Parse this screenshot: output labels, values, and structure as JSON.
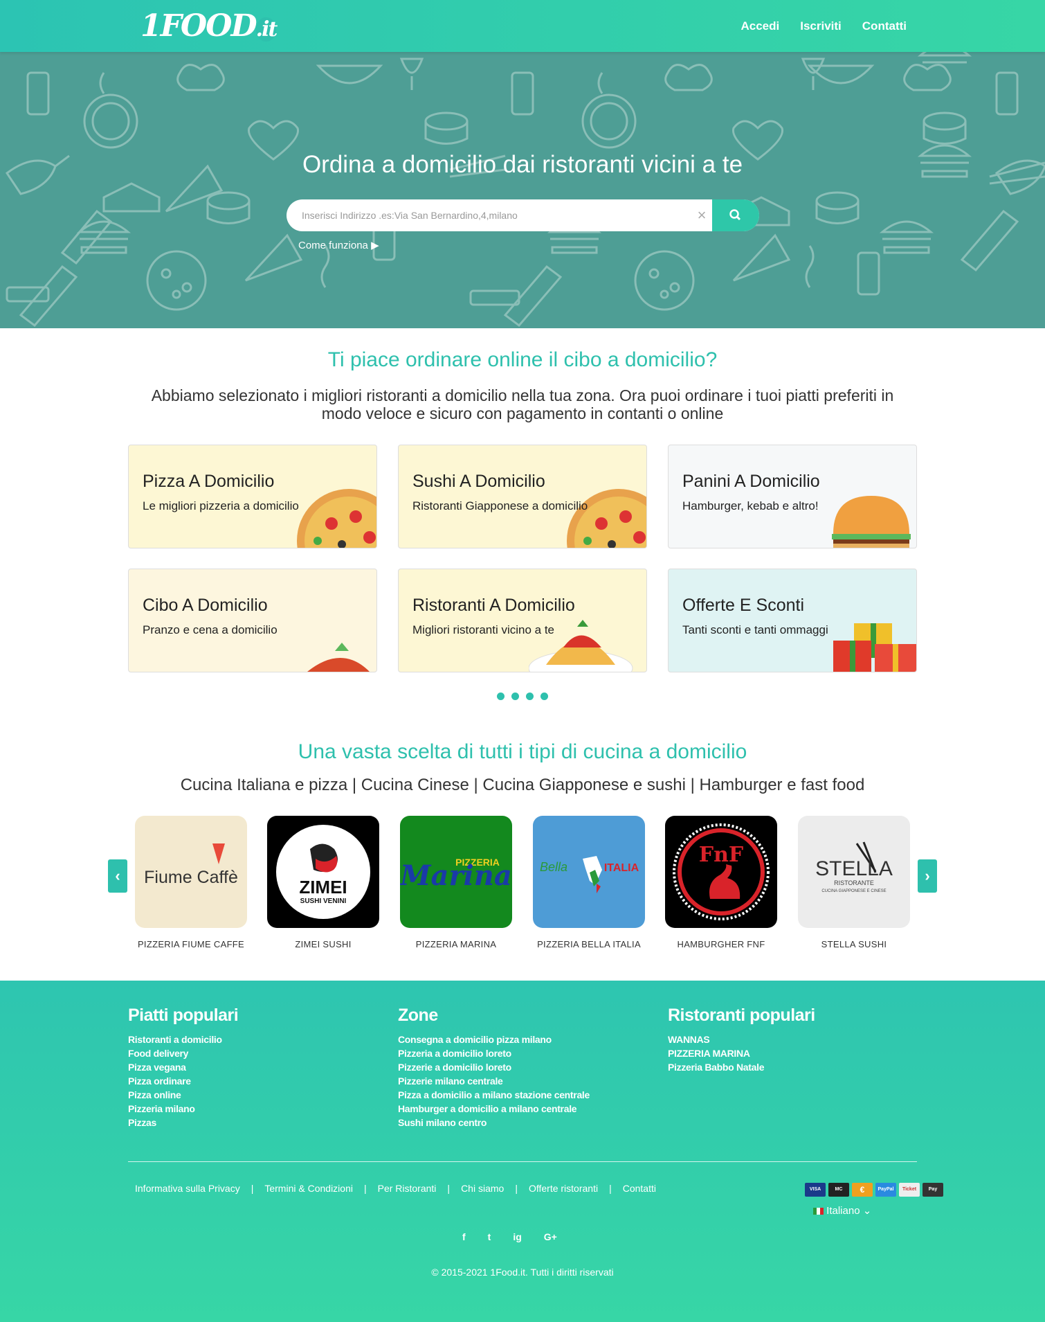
{
  "nav": {
    "logo": "1FOOD",
    "logo_suffix": ".it",
    "links": [
      "Accedi",
      "Iscriviti",
      "Contatti"
    ]
  },
  "hero": {
    "title": "Ordina a domicilio dai ristoranti vicini a te",
    "search_placeholder": "Inserisci Indirizzo .es:Via San Bernardino,4,milano",
    "clear": "×",
    "how_it_works": "Come funziona"
  },
  "intro": {
    "title": "Ti piace ordinare online il cibo a domicilio?",
    "text": "Abbiamo selezionato i migliori ristoranti a domicilio nella tua zona. Ora puoi ordinare i tuoi piatti preferiti in modo veloce e sicuro con pagamento in contanti o online"
  },
  "cards": [
    {
      "title": "Pizza A Domicilio",
      "subtitle": "Le migliori pizzeria a domicilio"
    },
    {
      "title": "Sushi A Domicilio",
      "subtitle": "Ristoranti Giapponese a domicilio"
    },
    {
      "title": "Panini A Domicilio",
      "subtitle": "Hamburger, kebab e altro!"
    },
    {
      "title": "Cibo A Domicilio",
      "subtitle": "Pranzo e cena a domicilio"
    },
    {
      "title": "Ristoranti A Domicilio",
      "subtitle": "Migliori ristoranti vicino a te"
    },
    {
      "title": "Offerte E Sconti",
      "subtitle": "Tanti sconti e tanti ommaggi"
    }
  ],
  "cuisine": {
    "title": "Una vasta scelta di tutti i tipi di cucina a domicilio",
    "list": "Cucina Italiana e pizza | Cucina Cinese | Cucina Giapponese e sushi | Hamburger e fast food"
  },
  "restaurants": [
    {
      "name": "PIZZERIA FIUME CAFFE",
      "logo_text": "Fiume Caffè"
    },
    {
      "name": "ZIMEI SUSHI",
      "logo_text": "ZIMEI",
      "logo_sub": "SUSHI VENINI"
    },
    {
      "name": "PIZZERIA MARINA",
      "logo_text": "Marina",
      "logo_sub": "PIZZERIA"
    },
    {
      "name": "PIZZERIA BELLA ITALIA",
      "logo_text": "Bella",
      "logo_sub": "ITALIA"
    },
    {
      "name": "HAMBURGHER FNF",
      "logo_text": "FnF"
    },
    {
      "name": "STELLA SUSHI",
      "logo_text": "STELLA",
      "logo_sub": "RISTORANTE",
      "logo_sub2": "CUCINA GIAPPONESE E CINESE"
    }
  ],
  "footer": {
    "col1": {
      "title": "Piatti populari",
      "links": [
        "Ristoranti a domicilio",
        "Food delivery",
        "Pizza vegana",
        "Pizza ordinare",
        "Pizza online",
        "Pizzeria milano",
        "Pizzas"
      ]
    },
    "col2": {
      "title": "Zone",
      "links": [
        "Consegna a domicilio pizza milano",
        "Pizzeria a domicilio loreto",
        "Pizzerie a domicilio loreto",
        "Pizzerie milano centrale",
        "Pizza a domicilio a milano stazione centrale",
        "Hamburger a domicilio a milano centrale",
        "Sushi milano centro"
      ]
    },
    "col3": {
      "title": "Ristoranti populari",
      "links": [
        "WANNAS",
        "PIZZERIA MARINA",
        "Pizzeria Babbo Natale"
      ]
    },
    "legal": [
      "Informativa sulla Privacy",
      "Termini & Condizioni",
      "Per Ristoranti",
      "Chi siamo",
      "Offerte ristoranti",
      "Contatti"
    ],
    "payments": [
      "VISA",
      "MC",
      "€",
      "PayPal",
      "Ticket",
      "Pay"
    ],
    "language": "Italiano",
    "social": [
      "f",
      "t",
      "ig",
      "G+"
    ],
    "copyright": "© 2015-2021 1Food.it. Tutti i diritti riservati"
  },
  "colors": {
    "primary": "#2ec0ad",
    "hero_bg": "#4e9e95",
    "footer_start": "#2ec5b0",
    "footer_end": "#37d6a6"
  }
}
